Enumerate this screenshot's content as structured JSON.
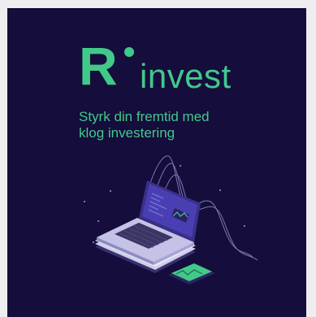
{
  "brand": {
    "logo_letter": "R",
    "logo_word": "invest"
  },
  "hero": {
    "tagline_line1": "Styrk din fremtid med",
    "tagline_line2": "klog investering"
  },
  "colors": {
    "background": "#150d3c",
    "accent": "#41c98a",
    "page": "#eeeef0"
  },
  "illustration": {
    "icon": "laptop-with-charts-illustration"
  }
}
